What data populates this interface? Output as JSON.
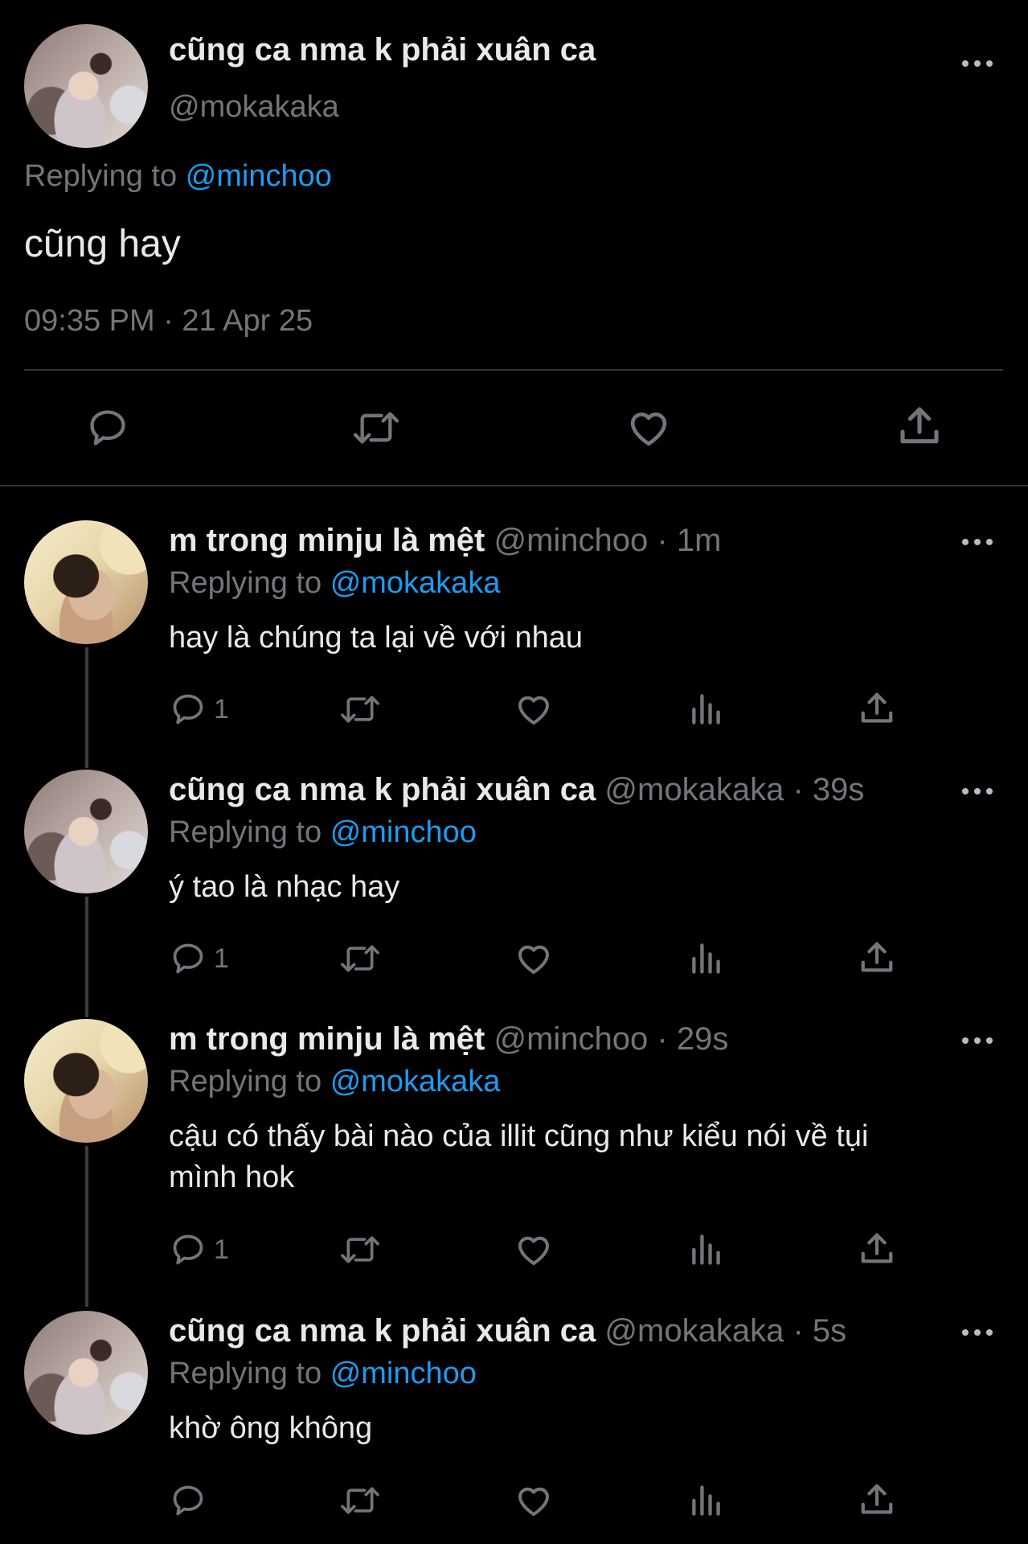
{
  "main_tweet": {
    "display_name": "cũng ca nma k phải xuân ca",
    "handle": "@mokakaka",
    "replying_prefix": "Replying to",
    "replying_to": "@minchoo",
    "text": "cũng hay",
    "timestamp": "09:35 PM · 21 Apr 25"
  },
  "replies": [
    {
      "display_name": "m trong minju là mệt",
      "handle": "@minchoo",
      "time": "· 1m",
      "replying_prefix": "Replying to",
      "replying_to": "@mokakaka",
      "text_lines": [
        "hay là chúng ta lại về với nhau"
      ],
      "reply_count": "1"
    },
    {
      "display_name": "cũng ca nma k phải xuân ca",
      "handle": "@mokakaka",
      "time": "· 39s",
      "replying_prefix": "Replying to",
      "replying_to": "@minchoo",
      "text_lines": [
        "ý tao là nhạc hay"
      ],
      "reply_count": "1"
    },
    {
      "display_name": "m trong minju là mệt",
      "handle": "@minchoo",
      "time": "· 29s",
      "replying_prefix": "Replying to",
      "replying_to": "@mokakaka",
      "text_lines": [
        "cậu có thấy bài nào của illit cũng như kiểu nói về tụi",
        "mình hok"
      ],
      "reply_count": "1"
    },
    {
      "display_name": "cũng ca nma k phải xuân ca",
      "handle": "@mokakaka",
      "time": "· 5s",
      "replying_prefix": "Replying to",
      "replying_to": "@minchoo",
      "text_lines": [
        "khờ ông không"
      ],
      "reply_count": ""
    }
  ],
  "icons": {
    "reply": "speech-bubble-icon",
    "retweet": "retweet-icon",
    "like": "heart-icon",
    "views": "bar-chart-icon",
    "share": "share-upload-icon",
    "more": "ellipsis-icon"
  },
  "colors": {
    "background": "#000000",
    "text": "#e7e9ea",
    "muted": "#71767b",
    "link": "#1d9bf0",
    "divider": "#2f3336"
  }
}
